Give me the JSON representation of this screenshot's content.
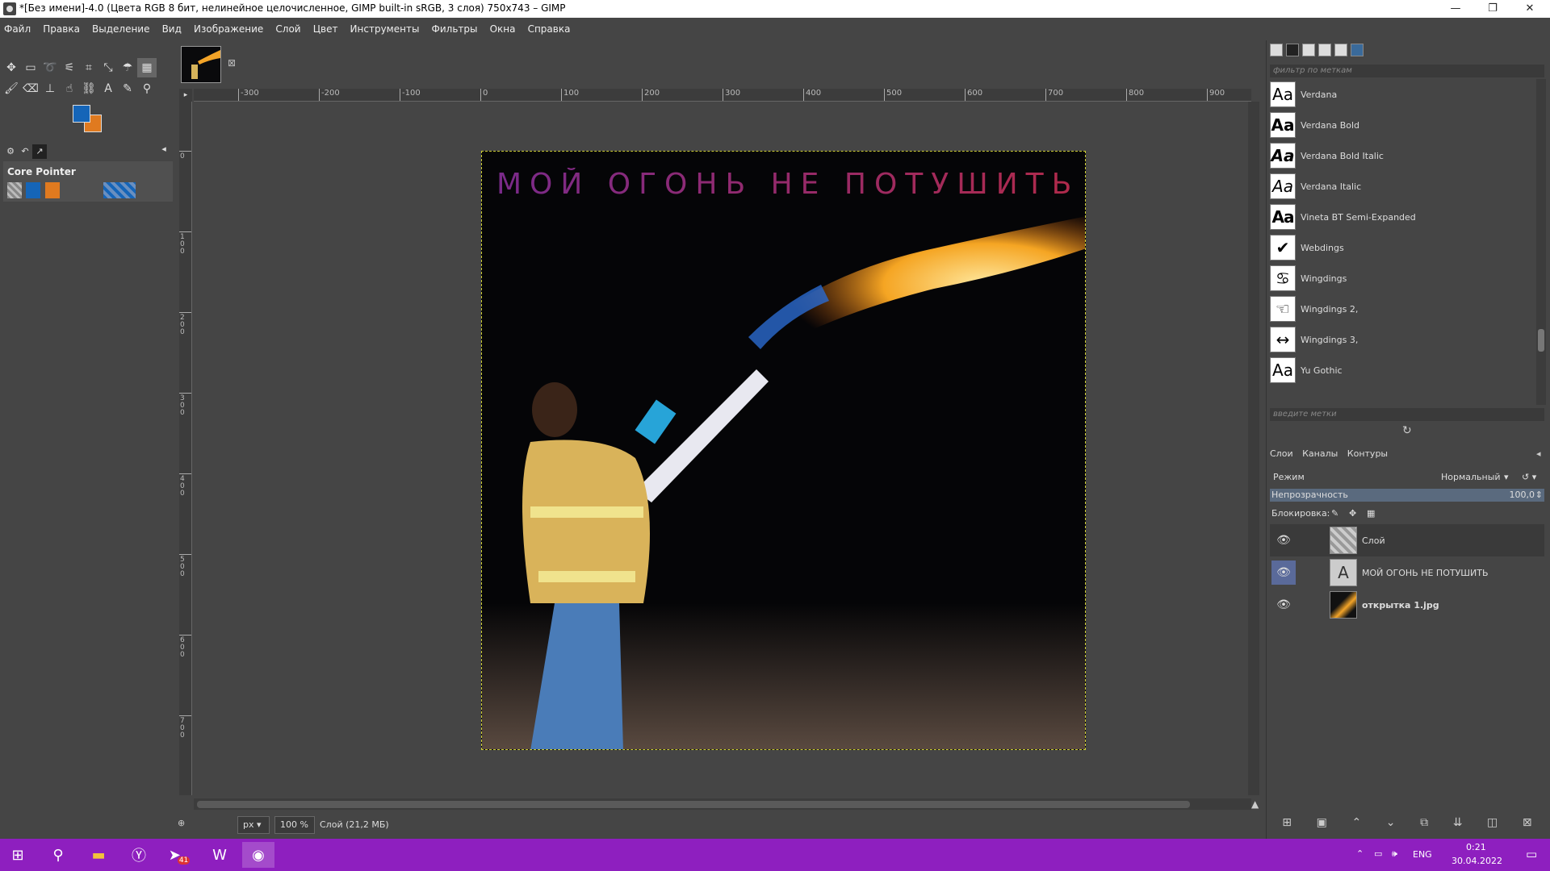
{
  "window": {
    "title": "*[Без имени]-4.0 (Цвета RGB 8 бит, нелинейное целочисленное, GIMP built-in sRGB, 3 слоя) 750x743 – GIMP",
    "minimize": "—",
    "maximize": "❐",
    "close": "✕"
  },
  "menu": [
    "Файл",
    "Правка",
    "Выделение",
    "Вид",
    "Изображение",
    "Слой",
    "Цвет",
    "Инструменты",
    "Фильтры",
    "Окна",
    "Справка"
  ],
  "tool_options": {
    "title": "Core Pointer"
  },
  "colors": {
    "foreground": "#1565b8",
    "background": "#e07a1f",
    "taskbar": "#8e1fbf"
  },
  "ruler": {
    "h_ticks": [
      "-300",
      "-200",
      "-100",
      "0",
      "100",
      "200",
      "300",
      "400",
      "500",
      "600",
      "700",
      "800",
      "900"
    ],
    "v_ticks": [
      "0",
      "100",
      "200",
      "300",
      "400",
      "500",
      "600",
      "700"
    ]
  },
  "image": {
    "text_layer": "МОЙ ОГОНЬ НЕ ПОТУШИТЬ"
  },
  "status": {
    "unit": "px",
    "zoom": "100 %",
    "info": "Слой (21,2 МБ)"
  },
  "fonts": {
    "filter_placeholder": "фильтр по меткам",
    "tags_placeholder": "введите метки",
    "items": [
      {
        "preview": "Aa",
        "name": "Verdana"
      },
      {
        "preview": "Aa",
        "name": "Verdana Bold"
      },
      {
        "preview": "Aa",
        "name": "Verdana Bold Italic"
      },
      {
        "preview": "Aa",
        "name": "Verdana Italic"
      },
      {
        "preview": "Aa",
        "name": "Vineta BT Semi-Expanded"
      },
      {
        "preview": "✔",
        "name": "Webdings"
      },
      {
        "preview": "♋",
        "name": "Wingdings"
      },
      {
        "preview": "☜",
        "name": "Wingdings 2,"
      },
      {
        "preview": "↔",
        "name": "Wingdings 3,"
      },
      {
        "preview": "Aa",
        "name": "Yu Gothic"
      }
    ]
  },
  "layers_panel": {
    "tabs": [
      "Слои",
      "Каналы",
      "Контуры"
    ],
    "mode_label": "Режим",
    "mode_value": "Нормальный",
    "opacity_label": "Непрозрачность",
    "opacity_value": "100,0",
    "lock_label": "Блокировка:",
    "layers": [
      {
        "name": "Слой"
      },
      {
        "name": "МОЙ ОГОНЬ НЕ ПОТУШИТЬ"
      },
      {
        "name": "открытка 1.jpg"
      }
    ]
  },
  "tray": {
    "lang": "ENG",
    "time": "0:21",
    "date": "30.04.2022",
    "telegram_badge": "41"
  }
}
